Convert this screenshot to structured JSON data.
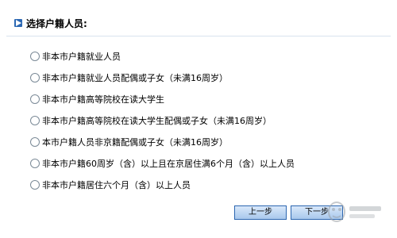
{
  "header": {
    "title": "选择户籍人员:",
    "icon": "play-arrow-icon",
    "accent_color": "#2c68b3"
  },
  "options": [
    {
      "label": "非本市户籍就业人员",
      "selected": false
    },
    {
      "label": "非本市户籍就业人员配偶或子女（未满16周岁）",
      "selected": false
    },
    {
      "label": "非本市户籍高等院校在读大学生",
      "selected": false
    },
    {
      "label": "非本市户籍高等院校在读大学生配偶或子女（未满16周岁）",
      "selected": false
    },
    {
      "label": "本市户籍人员非京籍配偶或子女（未满16周岁）",
      "selected": false
    },
    {
      "label": "非本市户籍60周岁（含）以上且在京居住满6个月（含）以上人员",
      "selected": false
    },
    {
      "label": "非本市户籍居住六个月（含）以上人员",
      "selected": false
    }
  ],
  "buttons": {
    "prev_label": "上一步",
    "next_label": "下一步"
  }
}
